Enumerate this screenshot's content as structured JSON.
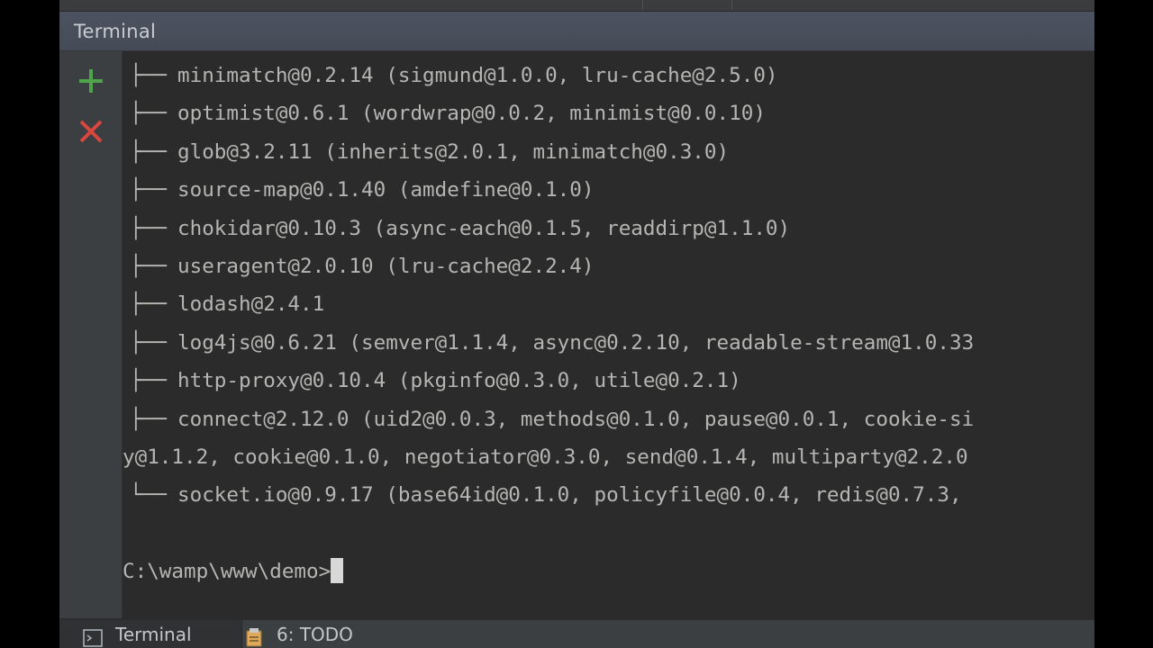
{
  "panel": {
    "title": "Terminal"
  },
  "toolbar": {
    "new_icon": "plus-icon",
    "close_icon": "close-icon",
    "accent_add": "#4fa34a",
    "accent_close": "#d9463e"
  },
  "terminal": {
    "tree_lines": [
      {
        "branch": "├──",
        "text": "minimatch@0.2.14 (sigmund@1.0.0, lru-cache@2.5.0)"
      },
      {
        "branch": "├──",
        "text": "optimist@0.6.1 (wordwrap@0.0.2, minimist@0.0.10)"
      },
      {
        "branch": "├──",
        "text": "glob@3.2.11 (inherits@2.0.1, minimatch@0.3.0)"
      },
      {
        "branch": "├──",
        "text": "source-map@0.1.40 (amdefine@0.1.0)"
      },
      {
        "branch": "├──",
        "text": "chokidar@0.10.3 (async-each@0.1.5, readdirp@1.1.0)"
      },
      {
        "branch": "├──",
        "text": "useragent@2.0.10 (lru-cache@2.2.4)"
      },
      {
        "branch": "├──",
        "text": "lodash@2.4.1"
      },
      {
        "branch": "├──",
        "text": "log4js@0.6.21 (semver@1.1.4, async@0.2.10, readable-stream@1.0.33"
      },
      {
        "branch": "├──",
        "text": "http-proxy@0.10.4 (pkginfo@0.3.0, utile@0.2.1)"
      },
      {
        "branch": "├──",
        "text": "connect@2.12.0 (uid2@0.0.3, methods@0.1.0, pause@0.0.1, cookie-si"
      }
    ],
    "wrapped_line": "y@1.1.2, cookie@0.1.0, negotiator@0.3.0, send@0.1.4, multiparty@2.2.0",
    "last_line": {
      "branch": "└──",
      "text": "socket.io@0.9.17 (base64id@0.1.0, policyfile@0.0.4, redis@0.7.3,"
    },
    "prompt": "C:\\wamp\\www\\demo>"
  },
  "bottom_tabs": [
    {
      "label": "Terminal",
      "icon": "terminal-icon",
      "active": true
    },
    {
      "label": "6: TODO",
      "icon": "todo-icon",
      "active": false
    }
  ]
}
